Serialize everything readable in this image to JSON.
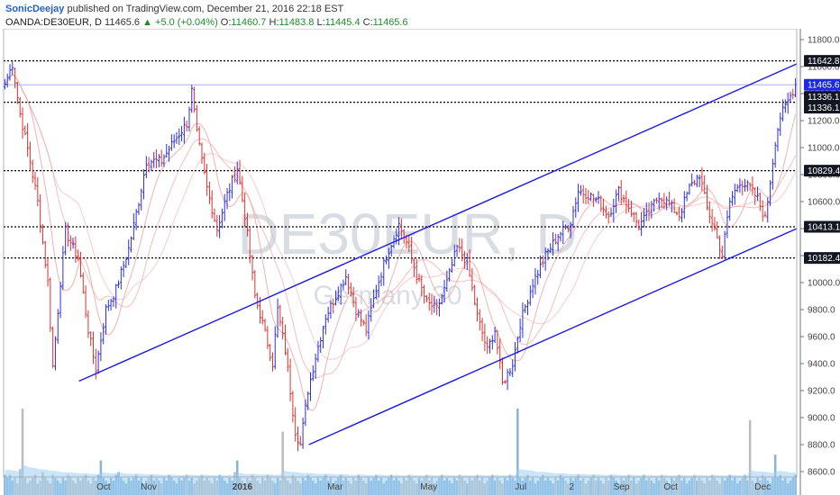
{
  "header": {
    "author": "SonicDeejay",
    "published_text": "published on TradingView.com, December 21, 2016 22:18 EST",
    "symbol_line": "OANDA:DE30EUR, D",
    "last": "11465.6",
    "change_arrow": "▲",
    "change": "+5.0 (+0.04%)",
    "open_label": "O:",
    "open": "11460.7",
    "high_label": "H:",
    "high": "11483.8",
    "low_label": "L:",
    "low": "11445.4",
    "close_label": "C:",
    "close": "11465.6"
  },
  "watermark": {
    "symbol": "DE30EUR, D",
    "name": "Germany 30"
  },
  "chart_data": {
    "type": "candlestick",
    "symbol": "OANDA:DE30EUR",
    "interval": "D",
    "x_ticks": [
      "Oct",
      "Nov",
      "2016",
      "Mar",
      "May",
      "Jul",
      "2",
      "Sep",
      "Oct",
      "Dec"
    ],
    "y_ticks": [
      11800,
      11600,
      11400,
      11200,
      11000,
      10800,
      10600,
      10400,
      10200,
      10000,
      9800,
      9600,
      9400,
      9200,
      9000,
      8800,
      8600
    ],
    "ylim": [
      8560,
      11880
    ],
    "horizontal_levels": [
      11642.8,
      11336.1,
      10829.4,
      10413.1,
      10182.4
    ],
    "price_badges": [
      {
        "label": "11642.8",
        "value": 11642.8,
        "color": "#131722"
      },
      {
        "label": "11465.6",
        "value": 11465.6,
        "color": "#1b28e6"
      },
      {
        "label": "11336.1",
        "value": 11336.1,
        "color": "#131722"
      },
      {
        "label": "11336.1",
        "value": 11336.1,
        "color": "#131722"
      },
      {
        "label": "10829.4",
        "value": 10829.4,
        "color": "#131722"
      },
      {
        "label": "10413.1",
        "value": 10413.1,
        "color": "#131722"
      },
      {
        "label": "10182.4",
        "value": 10182.4,
        "color": "#131722"
      }
    ],
    "channel_upper": {
      "from": {
        "t": 0.095,
        "price": 9270
      },
      "to": {
        "t": 1.0,
        "price": 11620
      }
    },
    "channel_lower": {
      "from": {
        "t": 0.385,
        "price": 8800
      },
      "to": {
        "t": 1.0,
        "price": 10400
      }
    },
    "anchors": [
      [
        0,
        11470
      ],
      [
        3,
        11620
      ],
      [
        6,
        11250
      ],
      [
        10,
        10900
      ],
      [
        13,
        10600
      ],
      [
        17,
        10000
      ],
      [
        19,
        9380
      ],
      [
        22,
        10000
      ],
      [
        24,
        10380
      ],
      [
        29,
        10180
      ],
      [
        33,
        9650
      ],
      [
        36,
        9360
      ],
      [
        40,
        9800
      ],
      [
        44,
        9950
      ],
      [
        49,
        10250
      ],
      [
        53,
        10600
      ],
      [
        56,
        10900
      ],
      [
        62,
        10900
      ],
      [
        67,
        11050
      ],
      [
        72,
        11180
      ],
      [
        74,
        11420
      ],
      [
        76,
        11100
      ],
      [
        80,
        10700
      ],
      [
        84,
        10400
      ],
      [
        88,
        10650
      ],
      [
        92,
        10850
      ],
      [
        95,
        10500
      ],
      [
        99,
        9900
      ],
      [
        102,
        9700
      ],
      [
        106,
        9400
      ],
      [
        108,
        9800
      ],
      [
        111,
        9500
      ],
      [
        115,
        8900
      ],
      [
        117,
        8800
      ],
      [
        120,
        9200
      ],
      [
        123,
        9450
      ],
      [
        127,
        9750
      ],
      [
        131,
        9900
      ],
      [
        135,
        10050
      ],
      [
        139,
        9800
      ],
      [
        143,
        9650
      ],
      [
        147,
        9950
      ],
      [
        151,
        10200
      ],
      [
        156,
        10430
      ],
      [
        159,
        10300
      ],
      [
        163,
        10050
      ],
      [
        167,
        9850
      ],
      [
        171,
        9800
      ],
      [
        175,
        10000
      ],
      [
        179,
        10260
      ],
      [
        183,
        10150
      ],
      [
        187,
        9750
      ],
      [
        191,
        9500
      ],
      [
        194,
        9650
      ],
      [
        197,
        9250
      ],
      [
        201,
        9400
      ],
      [
        204,
        9700
      ],
      [
        209,
        10000
      ],
      [
        214,
        10200
      ],
      [
        219,
        10350
      ],
      [
        224,
        10450
      ],
      [
        227,
        10680
      ],
      [
        231,
        10650
      ],
      [
        235,
        10600
      ],
      [
        239,
        10500
      ],
      [
        243,
        10680
      ],
      [
        247,
        10560
      ],
      [
        251,
        10420
      ],
      [
        255,
        10520
      ],
      [
        259,
        10650
      ],
      [
        263,
        10580
      ],
      [
        267,
        10500
      ],
      [
        271,
        10700
      ],
      [
        275,
        10800
      ],
      [
        278,
        10550
      ],
      [
        281,
        10400
      ],
      [
        284,
        10200
      ],
      [
        287,
        10600
      ],
      [
        291,
        10750
      ],
      [
        295,
        10700
      ],
      [
        298,
        10620
      ],
      [
        301,
        10470
      ],
      [
        303,
        10750
      ],
      [
        305,
        11050
      ],
      [
        307,
        11230
      ],
      [
        309,
        11300
      ],
      [
        311,
        11380
      ],
      [
        313,
        11465.6
      ]
    ],
    "volume_pattern": [
      7,
      6,
      7,
      5,
      6,
      4,
      9,
      30,
      6,
      4,
      5,
      6,
      7,
      4,
      5,
      8,
      6,
      5,
      4,
      7,
      6,
      5,
      4,
      6,
      5,
      7,
      6,
      5,
      4,
      6,
      5,
      6,
      7,
      5,
      4,
      6,
      5,
      7,
      12,
      6,
      5,
      4,
      6,
      5,
      7,
      8,
      6,
      5,
      4,
      6,
      5,
      6,
      7,
      5,
      6,
      4,
      5,
      6,
      7,
      5,
      6,
      5,
      4,
      6,
      5,
      7,
      6,
      5,
      4,
      6,
      5,
      6,
      7,
      5,
      6,
      4,
      5,
      6,
      7,
      5,
      6,
      5,
      4,
      6,
      5,
      7,
      6,
      5,
      4,
      6,
      5,
      8,
      12,
      6,
      5,
      4,
      6,
      5,
      7,
      6,
      5,
      4,
      6,
      5,
      7,
      6,
      5,
      4,
      6,
      5,
      22,
      6,
      5,
      4,
      7,
      6,
      5,
      4,
      6,
      5,
      7,
      6,
      5,
      4,
      6,
      5,
      6,
      7,
      5,
      6,
      4,
      5,
      6,
      7,
      5,
      6,
      5,
      4,
      6,
      5,
      7,
      6,
      5,
      4,
      6,
      5,
      6,
      7,
      5,
      6,
      4,
      5,
      6,
      7,
      5,
      6,
      5,
      4,
      6,
      5,
      7,
      6,
      5,
      4,
      6,
      5,
      6,
      7,
      5,
      6,
      4,
      5,
      6,
      7,
      5,
      6,
      5,
      4,
      6,
      5,
      7,
      6,
      5,
      4,
      6,
      5,
      6,
      7,
      5,
      6,
      4,
      5,
      6,
      7,
      5,
      6,
      5,
      4,
      6,
      5,
      7,
      6,
      5,
      30,
      6,
      5,
      6,
      7,
      5,
      6,
      4,
      5,
      6,
      7,
      5,
      6,
      5,
      4,
      6,
      5,
      7,
      6,
      5,
      4,
      6,
      5,
      6,
      7,
      5,
      6,
      4,
      5,
      6,
      7,
      5,
      6,
      5,
      4,
      6,
      5,
      7,
      6,
      5,
      4,
      6,
      5,
      6,
      7,
      5,
      6,
      4,
      5,
      6,
      7,
      5,
      6,
      5,
      4,
      6,
      5,
      7,
      6,
      5,
      4,
      6,
      5,
      6,
      7,
      5,
      6,
      4,
      5,
      6,
      7,
      5,
      6,
      5,
      4,
      6,
      5,
      7,
      6,
      5,
      4,
      6,
      5,
      6,
      7,
      5,
      6,
      4,
      5,
      6,
      7,
      5,
      26,
      5,
      4,
      6,
      5,
      7,
      6,
      5,
      4,
      6,
      14,
      6,
      7,
      5,
      6,
      4,
      5,
      6
    ]
  },
  "colors": {
    "up_candle": "#2b2fe0",
    "down_candle": "#e0312f",
    "volume_up": "#87b3db",
    "volume_down": "#bcbcbc",
    "volume_ma": "#9fd0f2",
    "channel": "#1a1ae6",
    "ma_lines": "#f0a3a3",
    "level_line": "#000000"
  }
}
